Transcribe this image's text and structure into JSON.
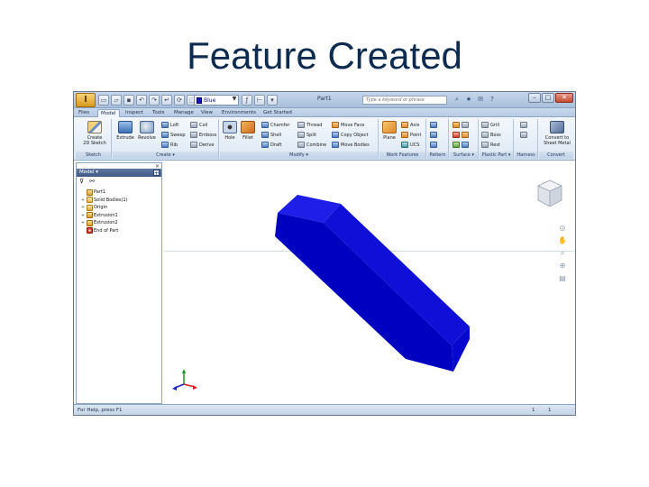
{
  "slide_title": "Feature Created",
  "titlebar": {
    "document_title": "Part1",
    "material": "Blue",
    "material_color": "#1414c8",
    "search_placeholder": "Type a keyword or phrase"
  },
  "tabs": [
    "Files",
    "Model",
    "Inspect",
    "Tools",
    "Manage",
    "View",
    "Environments",
    "Get Started"
  ],
  "active_tab": "Model",
  "ribbon": {
    "sketch": {
      "title": "Sketch",
      "create_2d_sketch_l1": "Create",
      "create_2d_sketch_l2": "2D Sketch"
    },
    "create": {
      "title": "Create",
      "extrude": "Extrude",
      "revolve": "Revolve",
      "loft": "Loft",
      "sweep": "Sweep",
      "rib": "Rib",
      "coil": "Coil",
      "emboss": "Emboss",
      "derive": "Derive"
    },
    "modify": {
      "title": "Modify",
      "hole": "Hole",
      "fillet": "Fillet",
      "chamfer": "Chamfer",
      "shell": "Shell",
      "draft": "Draft",
      "thread": "Thread",
      "split": "Split",
      "combine": "Combine",
      "move_face": "Move Face",
      "copy_object": "Copy Object",
      "move_bodies": "Move Bodies"
    },
    "work_features": {
      "title": "Work Features",
      "plane": "Plane",
      "axis": "Axis",
      "point": "Point",
      "ucs": "UCS"
    },
    "pattern": {
      "title": "Pattern"
    },
    "surface": {
      "title": "Surface"
    },
    "plastic_part": {
      "title": "Plastic Part",
      "grill": "Grill",
      "boss": "Boss",
      "rest": "Rest"
    },
    "harness": {
      "title": "Harness"
    },
    "convert": {
      "title": "Convert",
      "convert_l1": "Convert to",
      "convert_l2": "Sheet Metal"
    }
  },
  "browser": {
    "header": "Model",
    "tree": [
      {
        "label": "Part1",
        "icon": "part-icon",
        "expand": ""
      },
      {
        "label": "Solid Bodies(1)",
        "icon": "folder-icon",
        "expand": "+"
      },
      {
        "label": "Origin",
        "icon": "origin-folder-icon",
        "expand": "+"
      },
      {
        "label": "Extrusion1",
        "icon": "extrusion-icon",
        "expand": "+"
      },
      {
        "label": "Extrusion2",
        "icon": "extrusion-icon",
        "expand": "+"
      },
      {
        "label": "End of Part",
        "icon": "end-of-part-icon",
        "expand": ""
      }
    ]
  },
  "model": {
    "solid_color": "#0a0ad6"
  },
  "statusbar": {
    "help_text": "For Help, press F1",
    "count1": "1",
    "count2": "1"
  }
}
